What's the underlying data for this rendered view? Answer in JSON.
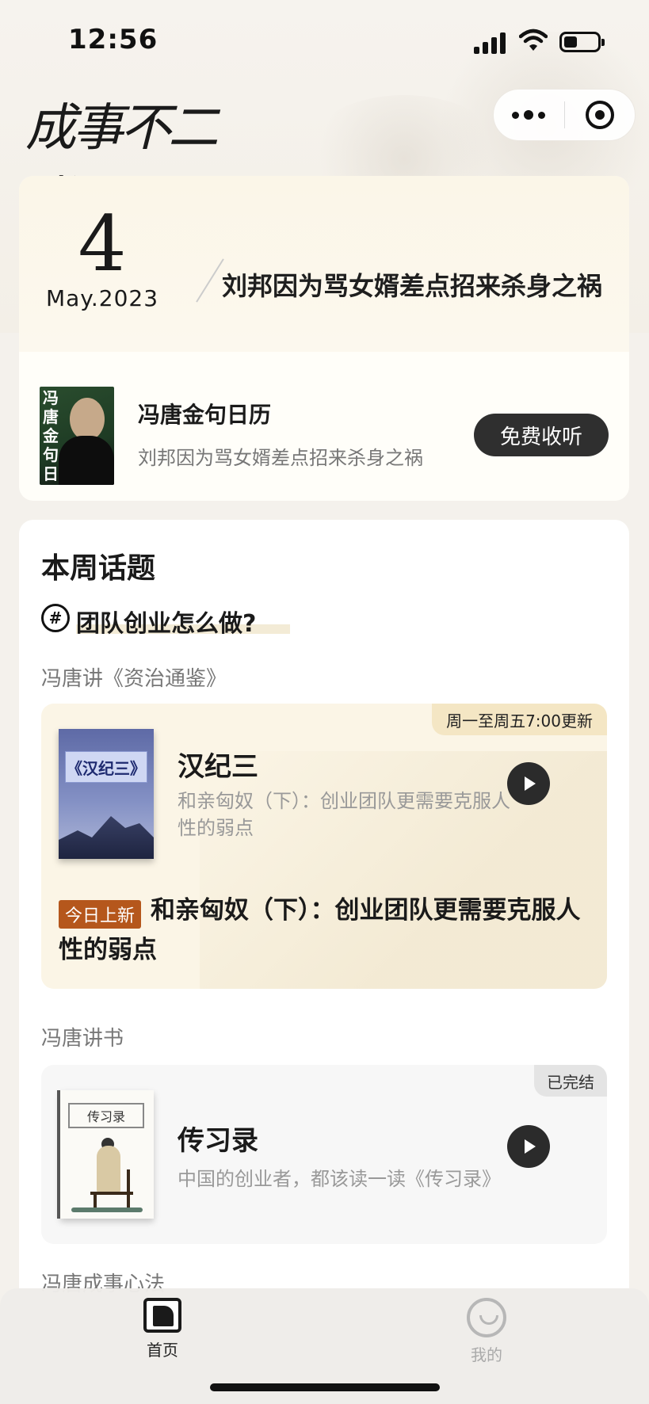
{
  "status_bar": {
    "time": "12:56",
    "battery_level": 0.4
  },
  "header": {
    "logo_text": "成事不二堂"
  },
  "calendar_card": {
    "day": "4",
    "month_year": "May.2023",
    "quote": "刘邦因为骂女婿差点招来杀身之祸",
    "book_cover_text": "冯唐金句日历",
    "title": "冯唐金句日历",
    "subtitle": "刘邦因为骂女婿差点招来杀身之祸",
    "button_label": "免费收听"
  },
  "weekly": {
    "section_title": "本周话题",
    "topic_symbol": "#",
    "topic": "团队创业怎么做?",
    "series1": {
      "label": "冯唐讲《资治通鉴》",
      "update_badge": "周一至周五7:00更新",
      "cover_text": "《汉纪三》",
      "title": "汉纪三",
      "desc": "和亲匈奴（下）：创业团队更需要克服人性的弱点",
      "new_badge": "今日上新",
      "episode": "和亲匈奴（下）：创业团队更需要克服人性的弱点"
    },
    "series2": {
      "label": "冯唐讲书",
      "done_badge": "已完结",
      "cover_text": "传习录",
      "title": "传习录",
      "desc": "中国的创业者，都该读一读《传习录》"
    },
    "series3": {
      "label": "冯唐成事心法"
    }
  },
  "tabbar": {
    "home_label": "首页",
    "me_label": "我的"
  }
}
